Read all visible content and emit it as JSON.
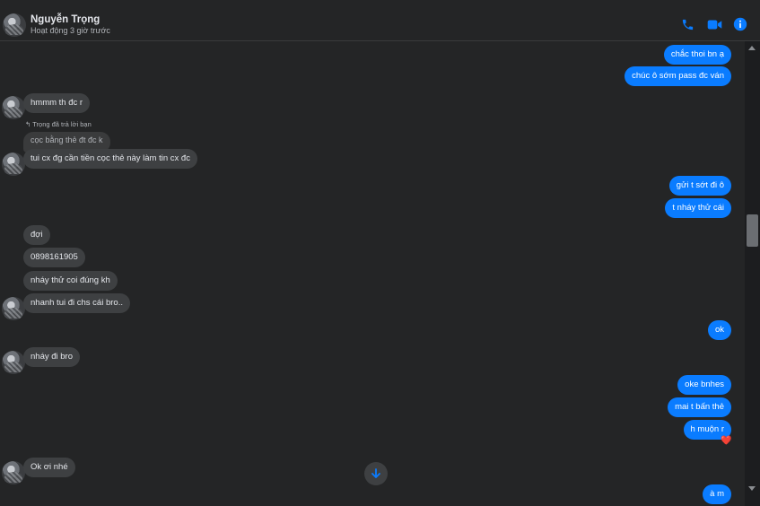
{
  "header": {
    "name": "Nguyễn Trọng",
    "status": "Hoạt động 3 giờ trước",
    "icons": [
      "phone-icon",
      "video-camera-icon",
      "info-icon"
    ],
    "accent_color": "#0a7cff"
  },
  "reply_hint": "↰ Trọng đã trả lời bạn",
  "messages": [
    {
      "from": "me",
      "text": "chắc thoi bn ạ"
    },
    {
      "from": "me",
      "text": "chúc ô sớm pass đc ván"
    },
    {
      "from": "them",
      "text": "hmmm th đc r"
    },
    {
      "from": "them",
      "quoted": "cọc bằng thẻ đt đc k",
      "text": "tui cx đg cần tiền cọc thẻ này làm tin cx đc"
    },
    {
      "from": "me",
      "text": "gửi t sớt đi ô"
    },
    {
      "from": "me",
      "text": "t nháy thử cái"
    },
    {
      "from": "them",
      "text": "đợi"
    },
    {
      "from": "them",
      "text": "0898161905"
    },
    {
      "from": "them",
      "text": "nháy thử coi đúng kh"
    },
    {
      "from": "them",
      "text": "nhanh tui đi chs cái bro.."
    },
    {
      "from": "me",
      "text": "ok"
    },
    {
      "from": "them",
      "text": "nháy đi bro"
    },
    {
      "from": "me",
      "text": "oke bnhes"
    },
    {
      "from": "me",
      "text": "mai t bấn thẻ"
    },
    {
      "from": "me",
      "text": "h muộn r",
      "reaction": "❤️"
    },
    {
      "from": "them",
      "text": "Ok ơi nhé"
    },
    {
      "from": "me",
      "text": "à m"
    }
  ]
}
